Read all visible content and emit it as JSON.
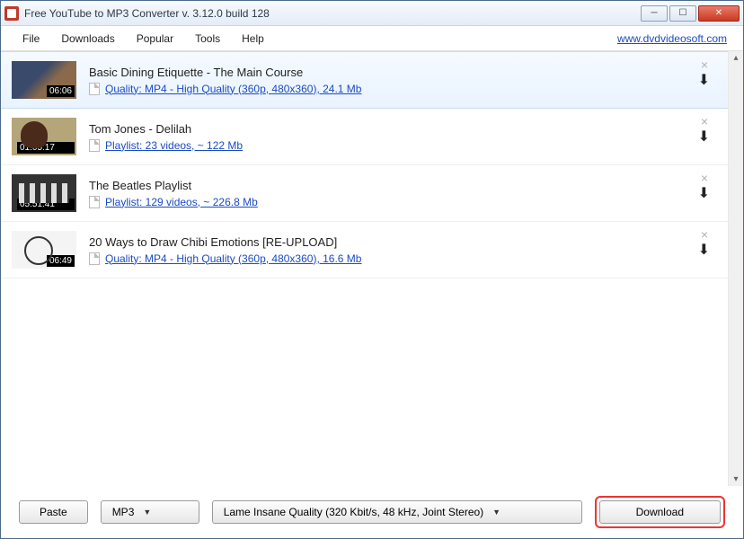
{
  "window": {
    "title": "Free YouTube to MP3 Converter  v. 3.12.0 build 128"
  },
  "menubar": {
    "items": [
      "File",
      "Downloads",
      "Popular",
      "Tools",
      "Help"
    ],
    "site_link": "www.dvdvideosoft.com"
  },
  "items": [
    {
      "title": "Basic Dining Etiquette - The Main Course",
      "subtitle": "Quality: MP4 - High Quality (360p, 480x360), 24.1 Mb",
      "duration": "06:06",
      "selected": true,
      "thumb_class": "t1"
    },
    {
      "title": "Tom Jones - Delilah",
      "subtitle": "Playlist: 23 videos, ~ 122 Mb",
      "duration": "01:05:17",
      "selected": false,
      "thumb_class": "t2"
    },
    {
      "title": "The Beatles Playlist",
      "subtitle": "Playlist: 129 videos, ~ 226.8 Mb",
      "duration": "05:51:41",
      "selected": false,
      "thumb_class": "t3"
    },
    {
      "title": "20 Ways to Draw Chibi Emotions [RE-UPLOAD]",
      "subtitle": "Quality: MP4 - High Quality (360p, 480x360), 16.6 Mb",
      "duration": "06:49",
      "selected": false,
      "thumb_class": "t4"
    }
  ],
  "bottombar": {
    "paste_label": "Paste",
    "format_value": "MP3",
    "quality_value": "Lame Insane Quality (320 Kbit/s, 48 kHz, Joint Stereo)",
    "download_label": "Download"
  }
}
